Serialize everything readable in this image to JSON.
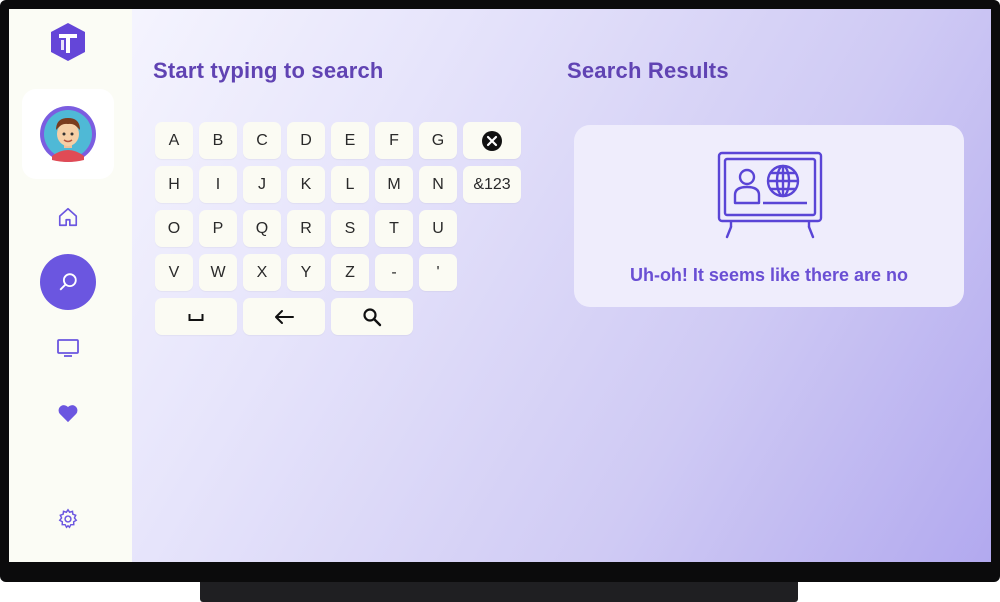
{
  "colors": {
    "accent": "#6b56e0",
    "heading": "#6043b3",
    "key_bg": "#fbfbf3",
    "sidebar_bg": "#fbfcf5",
    "results_card_bg": "#efedfc"
  },
  "sidebar": {
    "logo_icon": "t-hexagon-logo",
    "profile_icon": "user-avatar",
    "nav": [
      {
        "name": "home",
        "icon": "home-icon",
        "active": false
      },
      {
        "name": "search",
        "icon": "search-icon",
        "active": true
      },
      {
        "name": "tv",
        "icon": "tv-icon",
        "active": false
      },
      {
        "name": "favorites",
        "icon": "heart-icon",
        "active": false
      },
      {
        "name": "settings",
        "icon": "gear-icon",
        "active": false
      }
    ]
  },
  "search": {
    "heading": "Start typing to search"
  },
  "keyboard": {
    "rows": [
      [
        "A",
        "B",
        "C",
        "D",
        "E",
        "F",
        "G"
      ],
      [
        "H",
        "I",
        "J",
        "K",
        "L",
        "M",
        "N"
      ],
      [
        "O",
        "P",
        "Q",
        "R",
        "S",
        "T",
        "U"
      ],
      [
        "V",
        "W",
        "X",
        "Y",
        "Z",
        "-",
        "'"
      ]
    ],
    "symbols_label": "&123",
    "space_label": "␣",
    "clear_icon": "clear-icon",
    "backspace_icon": "backspace-arrow-icon",
    "submit_icon": "search-icon"
  },
  "results": {
    "heading": "Search Results",
    "illustration_icon": "tv-person-globe-icon",
    "message": "Uh-oh! It seems like there are no"
  }
}
